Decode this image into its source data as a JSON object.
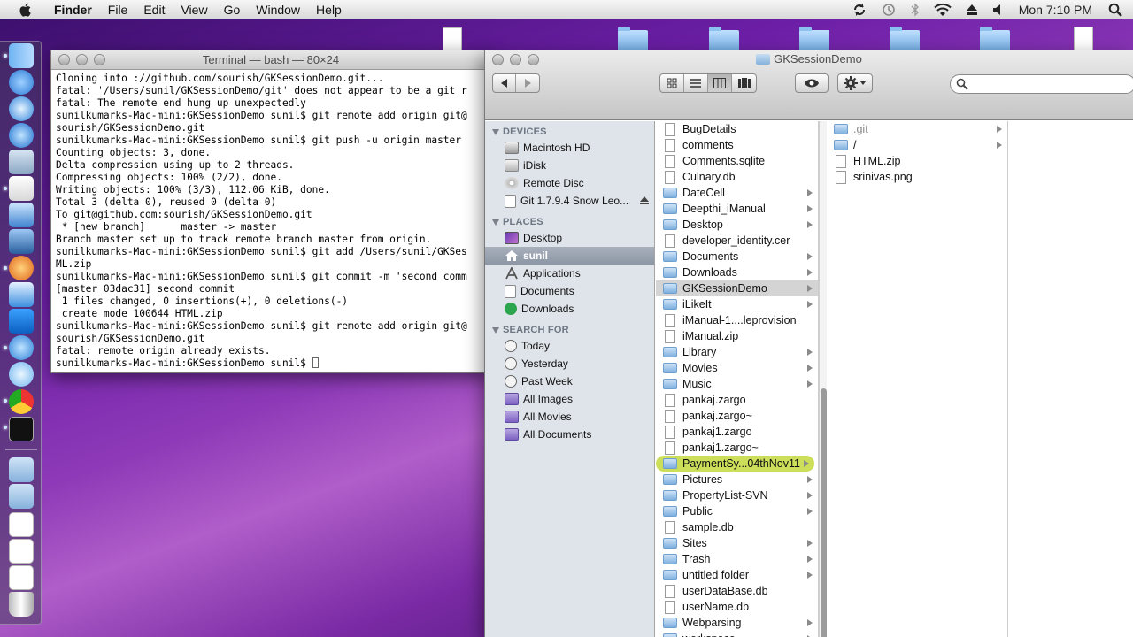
{
  "menubar": {
    "app": "Finder",
    "items": [
      "File",
      "Edit",
      "View",
      "Go",
      "Window",
      "Help"
    ],
    "clock": "Mon 7:10 PM"
  },
  "terminal": {
    "title": "Terminal — bash — 80×24",
    "lines": [
      "Cloning into ://github.com/sourish/GKSessionDemo.git...",
      "fatal: '/Users/sunil/GKSessionDemo/git' does not appear to be a git r",
      "fatal: The remote end hung up unexpectedly",
      "sunilkumarks-Mac-mini:GKSessionDemo sunil$ git remote add origin git@",
      "sourish/GKSessionDemo.git",
      "sunilkumarks-Mac-mini:GKSessionDemo sunil$ git push -u origin master",
      "Counting objects: 3, done.",
      "Delta compression using up to 2 threads.",
      "Compressing objects: 100% (2/2), done.",
      "Writing objects: 100% (3/3), 112.06 KiB, done.",
      "Total 3 (delta 0), reused 0 (delta 0)",
      "To git@github.com:sourish/GKSessionDemo.git",
      " * [new branch]      master -> master",
      "Branch master set up to track remote branch master from origin.",
      "sunilkumarks-Mac-mini:GKSessionDemo sunil$ git add /Users/sunil/GKSes",
      "ML.zip",
      "sunilkumarks-Mac-mini:GKSessionDemo sunil$ git commit -m 'second comm",
      "[master 03dac31] second commit",
      " 1 files changed, 0 insertions(+), 0 deletions(-)",
      " create mode 100644 HTML.zip",
      "sunilkumarks-Mac-mini:GKSessionDemo sunil$ git remote add origin git@",
      "sourish/GKSessionDemo.git",
      "fatal: remote origin already exists."
    ],
    "prompt": "sunilkumarks-Mac-mini:GKSessionDemo sunil$ "
  },
  "finder": {
    "title": "GKSessionDemo",
    "search_placeholder": "",
    "sidebar": {
      "devices_label": "DEVICES",
      "devices": [
        "Macintosh HD",
        "iDisk",
        "Remote Disc",
        "Git 1.7.9.4 Snow Leo..."
      ],
      "places_label": "PLACES",
      "places": [
        "Desktop",
        "sunil",
        "Applications",
        "Documents",
        "Downloads"
      ],
      "search_label": "SEARCH FOR",
      "searches": [
        "Today",
        "Yesterday",
        "Past Week",
        "All Images",
        "All Movies",
        "All Documents"
      ]
    },
    "column1": [
      {
        "name": "BugDetails",
        "kind": "doc"
      },
      {
        "name": "comments",
        "kind": "doc"
      },
      {
        "name": "Comments.sqlite",
        "kind": "doc"
      },
      {
        "name": "Culnary.db",
        "kind": "doc"
      },
      {
        "name": "DateCell",
        "kind": "folder"
      },
      {
        "name": "Deepthi_iManual",
        "kind": "folder"
      },
      {
        "name": "Desktop",
        "kind": "folder"
      },
      {
        "name": "developer_identity.cer",
        "kind": "doc"
      },
      {
        "name": "Documents",
        "kind": "folder"
      },
      {
        "name": "Downloads",
        "kind": "folder"
      },
      {
        "name": "GKSessionDemo",
        "kind": "folder",
        "state": "sel"
      },
      {
        "name": "iLikeIt",
        "kind": "folder"
      },
      {
        "name": "iManual-1....leprovision",
        "kind": "doc"
      },
      {
        "name": "iManual.zip",
        "kind": "doc"
      },
      {
        "name": "Library",
        "kind": "folder"
      },
      {
        "name": "Movies",
        "kind": "folder"
      },
      {
        "name": "Music",
        "kind": "folder"
      },
      {
        "name": "pankaj.zargo",
        "kind": "doc"
      },
      {
        "name": "pankaj.zargo~",
        "kind": "doc"
      },
      {
        "name": "pankaj1.zargo",
        "kind": "doc"
      },
      {
        "name": "pankaj1.zargo~",
        "kind": "doc"
      },
      {
        "name": "PaymentSy...04thNov11",
        "kind": "folder",
        "state": "hl"
      },
      {
        "name": "Pictures",
        "kind": "folder"
      },
      {
        "name": "PropertyList-SVN",
        "kind": "folder"
      },
      {
        "name": "Public",
        "kind": "folder"
      },
      {
        "name": "sample.db",
        "kind": "doc"
      },
      {
        "name": "Sites",
        "kind": "folder"
      },
      {
        "name": "Trash",
        "kind": "folder"
      },
      {
        "name": "untitled folder",
        "kind": "folder"
      },
      {
        "name": "userDataBase.db",
        "kind": "doc"
      },
      {
        "name": "userName.db",
        "kind": "doc"
      },
      {
        "name": "Webparsing",
        "kind": "folder"
      },
      {
        "name": "workspace",
        "kind": "folder"
      }
    ],
    "column2": [
      {
        "name": ".git",
        "kind": "folder",
        "state": "dim"
      },
      {
        "name": "/",
        "kind": "folder"
      },
      {
        "name": "HTML.zip",
        "kind": "doc"
      },
      {
        "name": "srinivas.png",
        "kind": "doc"
      }
    ]
  }
}
